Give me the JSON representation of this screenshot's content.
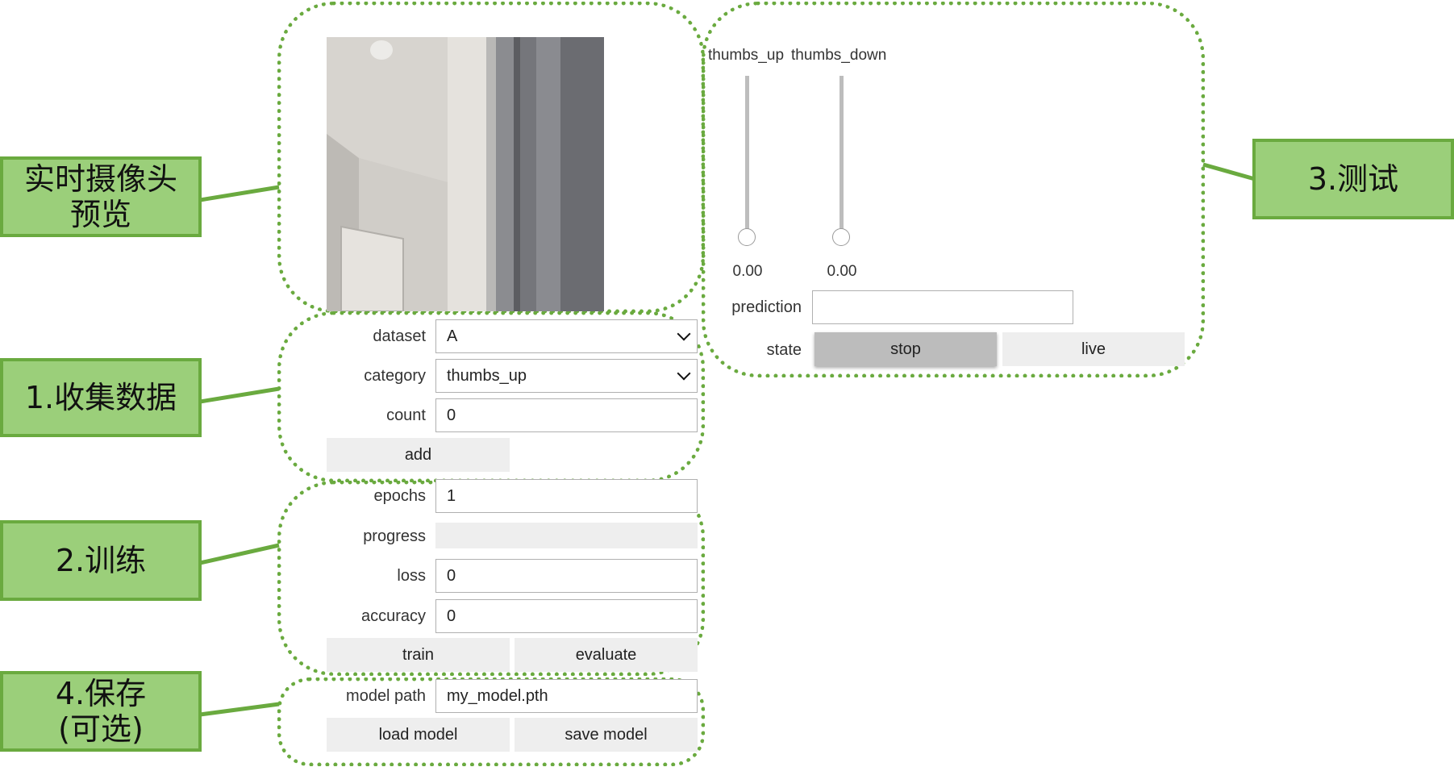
{
  "callouts": {
    "camera": {
      "line1": "实时摄像头",
      "line2": "预览"
    },
    "collect": {
      "text": "1.收集数据"
    },
    "train": {
      "text": "2.训练"
    },
    "test": {
      "text": "3.测试"
    },
    "save": {
      "line1": "4.保存",
      "line2": "(可选)"
    }
  },
  "collect": {
    "dataset_label": "dataset",
    "dataset_value": "A",
    "category_label": "category",
    "category_value": "thumbs_up",
    "count_label": "count",
    "count_value": "0",
    "add_label": "add"
  },
  "train": {
    "epochs_label": "epochs",
    "epochs_value": "1",
    "progress_label": "progress",
    "progress_value": 0,
    "loss_label": "loss",
    "loss_value": "0",
    "accuracy_label": "accuracy",
    "accuracy_value": "0",
    "train_label": "train",
    "evaluate_label": "evaluate"
  },
  "save": {
    "model_path_label": "model path",
    "model_path_value": "my_model.pth",
    "load_label": "load model",
    "save_label": "save model"
  },
  "test": {
    "sliders": [
      {
        "label": "thumbs_up",
        "value": "0.00",
        "level": 0.0
      },
      {
        "label": "thumbs_down",
        "value": "0.00",
        "level": 0.0
      }
    ],
    "prediction_label": "prediction",
    "prediction_value": "",
    "state_label": "state",
    "state_options": [
      "stop",
      "live"
    ],
    "state_selected": "stop"
  },
  "colors": {
    "callout_fill": "#9bcf7a",
    "callout_border": "#6aaa3f",
    "group_border": "#6aaa3f",
    "button_bg": "#eeeeee",
    "button_pressed_bg": "#bcbcbc"
  },
  "icons": [
    "chevron-down-icon",
    "slider-knob-icon"
  ]
}
